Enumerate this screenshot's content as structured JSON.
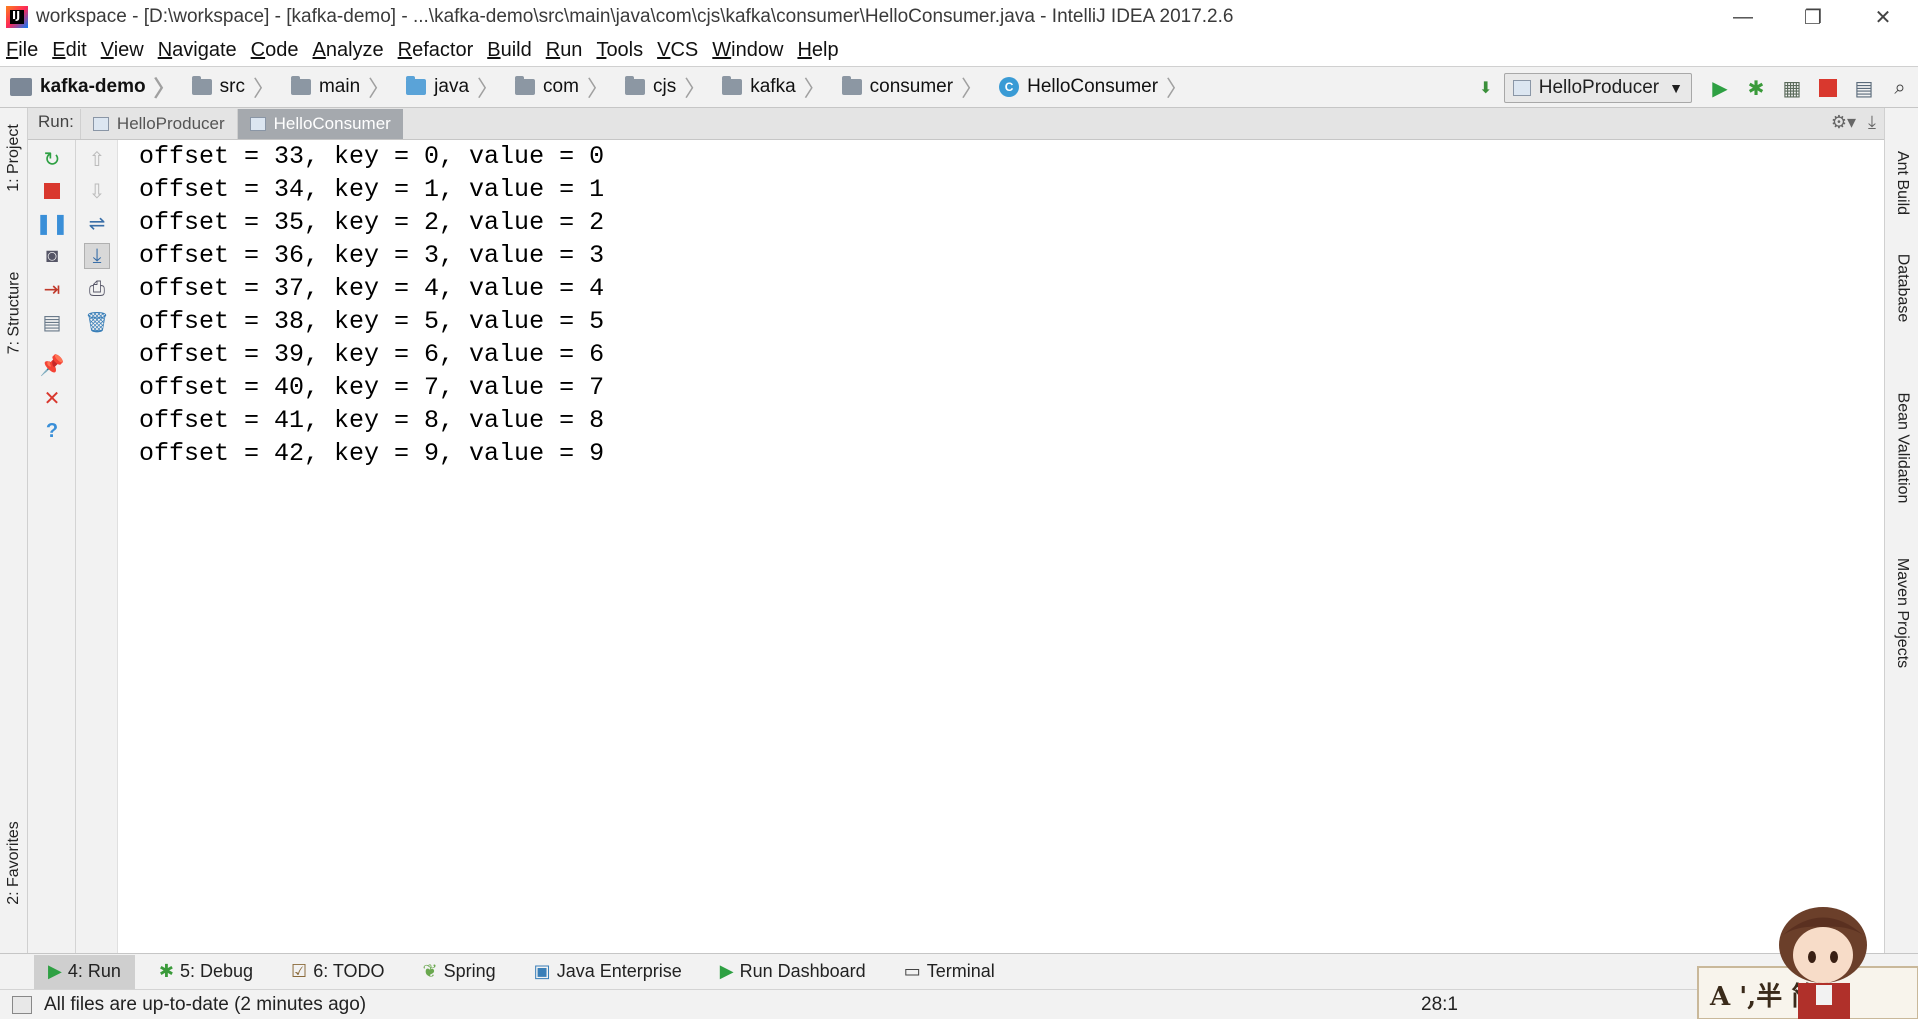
{
  "window": {
    "title": "workspace - [D:\\workspace] - [kafka-demo] - ...\\kafka-demo\\src\\main\\java\\com\\cjs\\kafka\\consumer\\HelloConsumer.java - IntelliJ IDEA 2017.2.6",
    "minimize": "—",
    "restore": "❐",
    "close": "✕"
  },
  "menu": [
    "File",
    "Edit",
    "View",
    "Navigate",
    "Code",
    "Analyze",
    "Refactor",
    "Build",
    "Run",
    "Tools",
    "VCS",
    "Window",
    "Help"
  ],
  "breadcrumbs": [
    "kafka-demo",
    "src",
    "main",
    "java",
    "com",
    "cjs",
    "kafka",
    "consumer",
    "HelloConsumer"
  ],
  "run_config": "HelloProducer",
  "run_panel": {
    "label": "Run:",
    "tabs": [
      "HelloProducer",
      "HelloConsumer"
    ],
    "active_tab": "HelloConsumer"
  },
  "console_lines": [
    "offset = 33, key = 0, value = 0",
    "offset = 34, key = 1, value = 1",
    "offset = 35, key = 2, value = 2",
    "offset = 36, key = 3, value = 3",
    "offset = 37, key = 4, value = 4",
    "offset = 38, key = 5, value = 5",
    "offset = 39, key = 6, value = 6",
    "offset = 40, key = 7, value = 7",
    "offset = 41, key = 8, value = 8",
    "offset = 42, key = 9, value = 9"
  ],
  "left_tool_windows": [
    "1: Project",
    "7: Structure",
    "2: Favorites"
  ],
  "right_tool_windows": [
    "Ant Build",
    "Database",
    "Bean Validation",
    "Maven Projects"
  ],
  "bottom_tabs": [
    {
      "label": "4: Run",
      "icon": "run-icon"
    },
    {
      "label": "5: Debug",
      "icon": "debug-icon"
    },
    {
      "label": "6: TODO",
      "icon": "todo-icon"
    },
    {
      "label": "Spring",
      "icon": "spring-icon"
    },
    {
      "label": "Java Enterprise",
      "icon": "java-enterprise-icon"
    },
    {
      "label": "Run Dashboard",
      "icon": "run-dashboard-icon"
    },
    {
      "label": "Terminal",
      "icon": "terminal-icon"
    }
  ],
  "status": {
    "message": "All files are up-to-date (2 minutes ago)",
    "position": "28:1"
  },
  "watermark_text": "A ',半 简"
}
